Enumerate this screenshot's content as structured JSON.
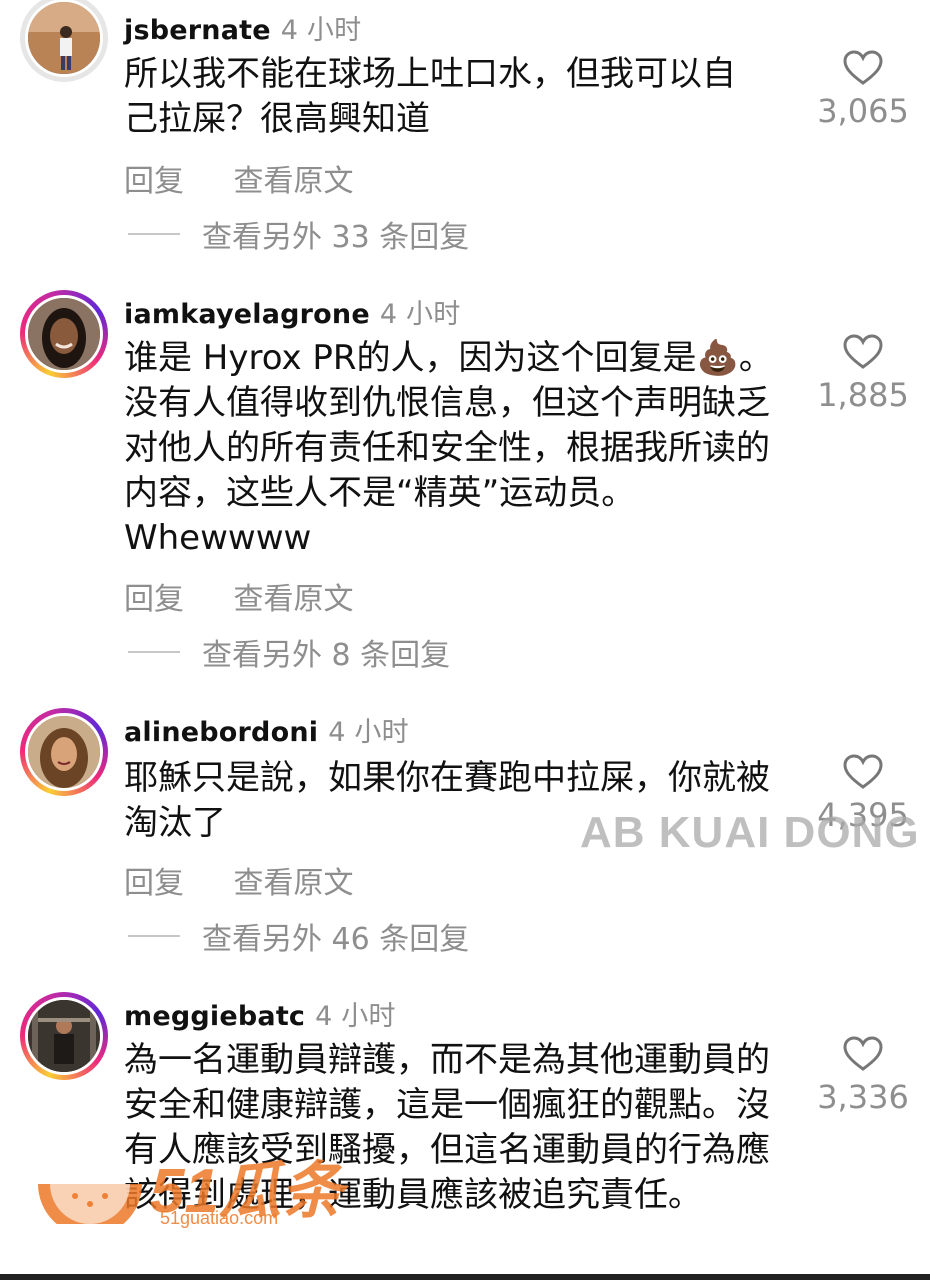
{
  "comments": [
    {
      "username": "jsbernate",
      "time": "4 小时",
      "text": "所以我不能在球场上吐口水，但我可以自己拉屎？很高興知道",
      "likes": "3,065",
      "reply": "回复",
      "translate": "查看原文",
      "more_replies": "查看另外 33 条回复"
    },
    {
      "username": "iamkayelagrone",
      "time": "4 小时",
      "text": "谁是 Hyrox PR的人，因为这个回复是💩。没有人值得收到仇恨信息，但这个声明缺乏对他人的所有责任和安全性，根据我所读的内容，这些人不是“精英”运动员。Whewwww",
      "likes": "1,885",
      "reply": "回复",
      "translate": "查看原文",
      "more_replies": "查看另外 8 条回复"
    },
    {
      "username": "alinebordoni",
      "time": "4 小时",
      "text": "耶穌只是說，如果你在賽跑中拉屎，你就被淘汰了",
      "likes": "4,395",
      "reply": "回复",
      "translate": "查看原文",
      "more_replies": "查看另外 46 条回复"
    },
    {
      "username": "meggiebatc",
      "time": "4 小时",
      "text": "為一名運動員辯護，而不是為其他運動員的安全和健康辯護，這是一個瘋狂的觀點。沒有人應該受到騷擾，但這名運動員的行為應該得到處理，運動員應該被追究責任。",
      "likes": "3,336"
    }
  ],
  "watermark": {
    "text": "AB KUAI DONG",
    "logo_brand": "51瓜条",
    "logo_domain": "51guatiao.com"
  },
  "colors": {
    "secondary_text": "#8e8e8e",
    "story_ring": "#ee2a7b",
    "logo_orange": "#ec7828"
  },
  "icons": [
    "heart-icon",
    "avatar"
  ]
}
